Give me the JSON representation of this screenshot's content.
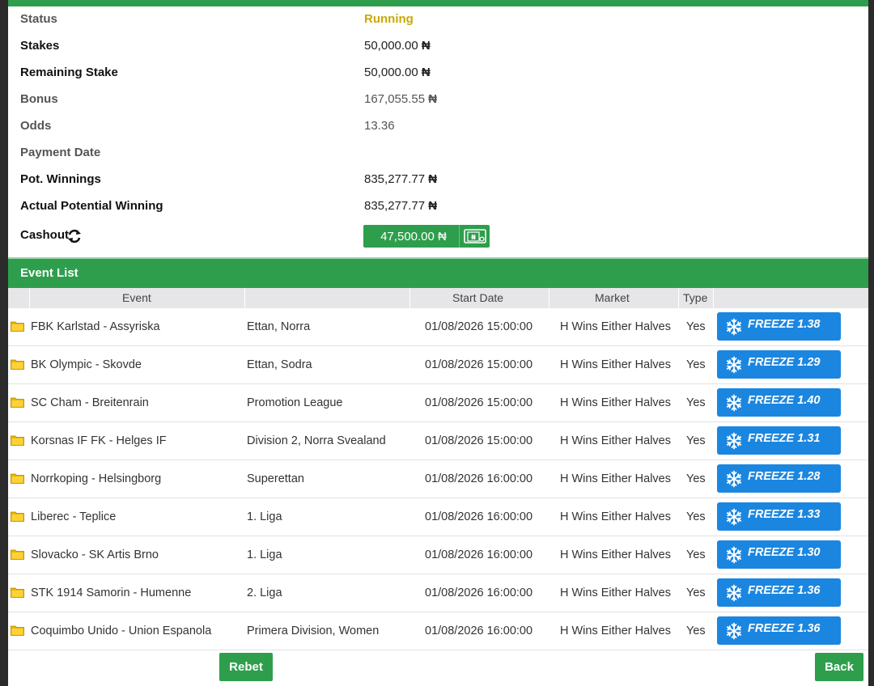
{
  "details": {
    "status": {
      "label": "Status",
      "value": "Running"
    },
    "stakes": {
      "label": "Stakes",
      "value": "50,000.00",
      "currency": "₦"
    },
    "remaining_stake": {
      "label": "Remaining Stake",
      "value": "50,000.00",
      "currency": "₦"
    },
    "bonus": {
      "label": "Bonus",
      "value": "167,055.55",
      "currency": "₦"
    },
    "odds": {
      "label": "Odds",
      "value": "13.36"
    },
    "payment_date": {
      "label": "Payment Date",
      "value": ""
    },
    "pot_winnings": {
      "label": "Pot. Winnings",
      "value": "835,277.77",
      "currency": "₦"
    },
    "actual_potential_winning": {
      "label": "Actual Potential Winning",
      "value": "835,277.77",
      "currency": "₦"
    },
    "cashout": {
      "label": "Cashout",
      "amount": "47,500.00 ₦"
    }
  },
  "event_list": {
    "title": "Event List",
    "columns": {
      "event": "Event",
      "start_date": "Start Date",
      "market": "Market",
      "type": "Type"
    },
    "rows": [
      {
        "event": "FBK Karlstad - Assyriska",
        "league": "Ettan, Norra",
        "start": "01/08/2026 15:00:00",
        "market": "H Wins Either Halves",
        "type": "Yes",
        "freeze": "FREEZE 1.38"
      },
      {
        "event": "BK Olympic - Skovde",
        "league": "Ettan, Sodra",
        "start": "01/08/2026 15:00:00",
        "market": "H Wins Either Halves",
        "type": "Yes",
        "freeze": "FREEZE 1.29"
      },
      {
        "event": "SC Cham - Breitenrain",
        "league": "Promotion League",
        "start": "01/08/2026 15:00:00",
        "market": "H Wins Either Halves",
        "type": "Yes",
        "freeze": "FREEZE 1.40"
      },
      {
        "event": "Korsnas IF FK - Helges IF",
        "league": "Division 2, Norra Svealand",
        "start": "01/08/2026 15:00:00",
        "market": "H Wins Either Halves",
        "type": "Yes",
        "freeze": "FREEZE 1.31"
      },
      {
        "event": "Norrkoping - Helsingborg",
        "league": "Superettan",
        "start": "01/08/2026 16:00:00",
        "market": "H Wins Either Halves",
        "type": "Yes",
        "freeze": "FREEZE 1.28"
      },
      {
        "event": "Liberec - Teplice",
        "league": "1. Liga",
        "start": "01/08/2026 16:00:00",
        "market": "H Wins Either Halves",
        "type": "Yes",
        "freeze": "FREEZE 1.33"
      },
      {
        "event": "Slovacko - SK Artis Brno",
        "league": "1. Liga",
        "start": "01/08/2026 16:00:00",
        "market": "H Wins Either Halves",
        "type": "Yes",
        "freeze": "FREEZE 1.30"
      },
      {
        "event": "STK 1914 Samorin - Humenne",
        "league": "2. Liga",
        "start": "01/08/2026 16:00:00",
        "market": "H Wins Either Halves",
        "type": "Yes",
        "freeze": "FREEZE 1.36"
      },
      {
        "event": "Coquimbo Unido - Union Espanola",
        "league": "Primera Division, Women",
        "start": "01/08/2026 16:00:00",
        "market": "H Wins Either Halves",
        "type": "Yes",
        "freeze": "FREEZE 1.36"
      }
    ]
  },
  "actions": {
    "rebet": "Rebet",
    "back": "Back"
  },
  "colors": {
    "accent_green": "#2e9e4d",
    "freeze_blue": "#1b86e0",
    "running_yellow": "#c9a800"
  },
  "icons": {
    "row": "folder-icon",
    "freeze": "snowflake-icon",
    "cashout": "banknote-icon",
    "refresh": "refresh-icon"
  }
}
